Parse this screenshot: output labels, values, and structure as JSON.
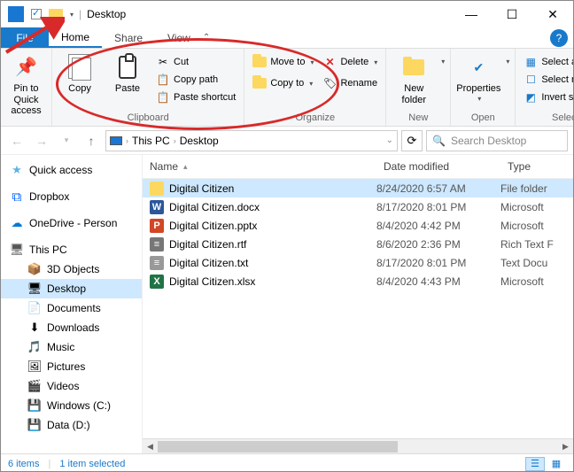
{
  "titlebar": {
    "title": "Desktop"
  },
  "tabs": {
    "file": "File",
    "home": "Home",
    "share": "Share",
    "view": "View"
  },
  "ribbon": {
    "navigation": {
      "label": "",
      "pin": "Pin to Quick access"
    },
    "clipboard": {
      "label": "Clipboard",
      "copy": "Copy",
      "paste": "Paste",
      "cut": "Cut",
      "copypath": "Copy path",
      "pasteshortcut": "Paste shortcut"
    },
    "organize": {
      "label": "Organize",
      "moveto": "Move to",
      "copyto": "Copy to",
      "delete": "Delete",
      "rename": "Rename"
    },
    "new": {
      "label": "New",
      "newfolder": "New folder"
    },
    "open": {
      "label": "Open",
      "properties": "Properties"
    },
    "select": {
      "label": "Select",
      "selectall": "Select all",
      "selectnone": "Select none",
      "invert": "Invert selection"
    }
  },
  "breadcrumb": {
    "p1": "This PC",
    "p2": "Desktop"
  },
  "search": {
    "placeholder": "Search Desktop"
  },
  "nav": {
    "quick": "Quick access",
    "dropbox": "Dropbox",
    "onedrive": "OneDrive - Person",
    "thispc": "This PC",
    "items": [
      "3D Objects",
      "Desktop",
      "Documents",
      "Downloads",
      "Music",
      "Pictures",
      "Videos",
      "Windows (C:)",
      "Data (D:)"
    ]
  },
  "headers": {
    "name": "Name",
    "date": "Date modified",
    "type": "Type"
  },
  "files": [
    {
      "name": "Digital Citizen",
      "date": "8/24/2020 6:57 AM",
      "type": "File folder",
      "icon": "fold",
      "sel": true
    },
    {
      "name": "Digital Citizen.docx",
      "date": "8/17/2020 8:01 PM",
      "type": "Microsoft",
      "icon": "docx",
      "sel": false
    },
    {
      "name": "Digital Citizen.pptx",
      "date": "8/4/2020 4:42 PM",
      "type": "Microsoft",
      "icon": "pptx",
      "sel": false
    },
    {
      "name": "Digital Citizen.rtf",
      "date": "8/6/2020 2:36 PM",
      "type": "Rich Text F",
      "icon": "rtf",
      "sel": false
    },
    {
      "name": "Digital Citizen.txt",
      "date": "8/17/2020 8:01 PM",
      "type": "Text Docu",
      "icon": "txt",
      "sel": false
    },
    {
      "name": "Digital Citizen.xlsx",
      "date": "8/4/2020 4:43 PM",
      "type": "Microsoft",
      "icon": "xlsx",
      "sel": false
    }
  ],
  "status": {
    "count": "6 items",
    "selected": "1 item selected"
  }
}
